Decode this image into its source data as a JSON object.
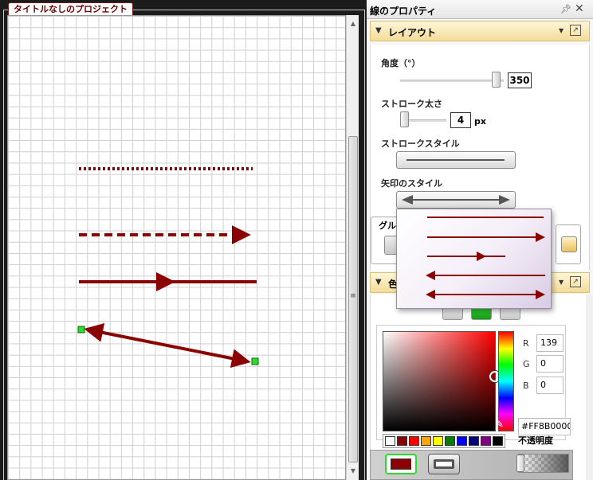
{
  "canvas": {
    "tab_title": "タイトルなしのプロジェクト",
    "line_color": "#8B0000",
    "handle_color": "#2bdc2b"
  },
  "panel": {
    "title": "線のプロパティ",
    "layout_section": {
      "label": "レイアウト",
      "angle": {
        "label": "角度（°）",
        "value": "350",
        "fraction": 0.97
      },
      "stroke_width": {
        "label": "ストローク太さ",
        "value": "4",
        "unit": "px",
        "fraction": 0.0
      },
      "stroke_style": {
        "label": "ストロークスタイル"
      },
      "arrow_style": {
        "label": "矢印のスタイル",
        "options": [
          "none",
          "end",
          "middle",
          "start",
          "both"
        ]
      },
      "group_label": "グル"
    },
    "color_section": {
      "label": "色",
      "rgb": {
        "r_label": "R",
        "g_label": "G",
        "b_label": "B",
        "r": "139",
        "g": "0",
        "b": "0"
      },
      "hex": "#FF8B0000",
      "opacity_label": "不透明度",
      "swatches": [
        "#ffffff",
        "#8b0000",
        "#ff0000",
        "#ffa500",
        "#ffff00",
        "#008000",
        "#0000ff",
        "#000080",
        "#800080",
        "#000000"
      ]
    }
  },
  "icons": {
    "pin": "pin-icon",
    "close": "close-icon",
    "collapse": "collapse-triangle-icon",
    "dropdown": "chevron-down-icon",
    "external": "popout-icon",
    "eyedropper": "eyedropper-icon"
  }
}
